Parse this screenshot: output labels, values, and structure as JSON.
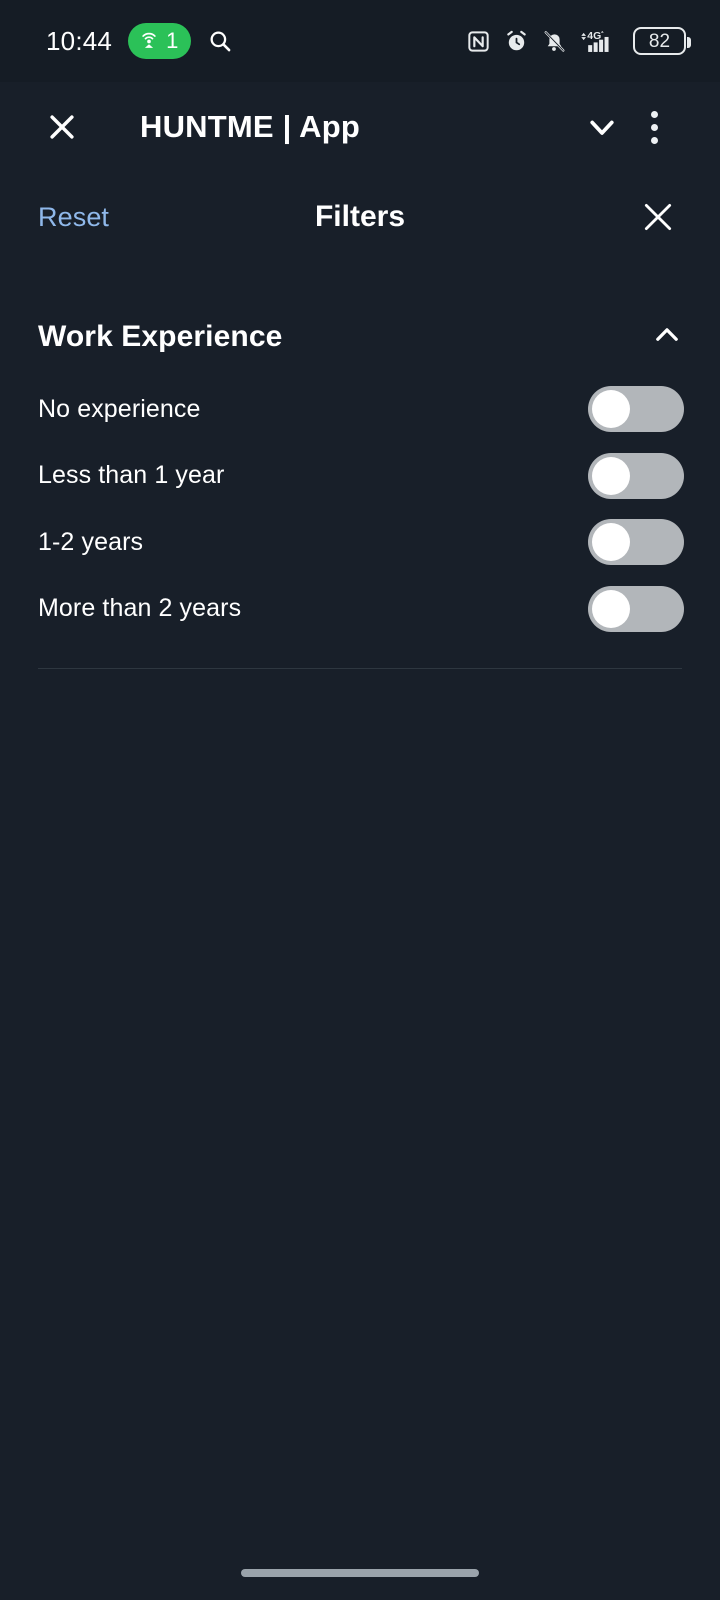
{
  "status_bar": {
    "time": "10:44",
    "hotspot": {
      "icon": "hotspot-icon",
      "count": "1"
    },
    "search_icon": "search-icon",
    "icons": [
      "nfc-icon",
      "alarm-icon",
      "notifications-off-icon",
      "signal-4g-icon"
    ],
    "network_label": "4G",
    "battery_percent": "82"
  },
  "app_bar": {
    "close_label": "close-icon",
    "title": "HUNTME | App",
    "expand_icon": "chevron-down-icon",
    "overflow_icon": "more-vertical-icon"
  },
  "filters_header": {
    "reset_label": "Reset",
    "title": "Filters",
    "close_icon": "close-icon"
  },
  "sections": [
    {
      "title": "Work Experience",
      "expanded": true,
      "collapse_icon": "chevron-up-icon",
      "options": [
        {
          "label": "No experience",
          "enabled": false
        },
        {
          "label": "Less than 1 year",
          "enabled": false
        },
        {
          "label": "1-2 years",
          "enabled": false
        },
        {
          "label": "More than 2 years",
          "enabled": false
        }
      ]
    }
  ],
  "colors": {
    "background": "#181f29",
    "status_bar_bg": "#151c25",
    "accent_link": "#8fb8ea",
    "hotspot_green": "#2bc158",
    "toggle_track_off": "#b2b6ba",
    "toggle_knob": "#ffffff",
    "divider": "#2e3740",
    "text_primary": "#ffffff"
  },
  "gesture_bar": {
    "handle": "home-handle"
  }
}
